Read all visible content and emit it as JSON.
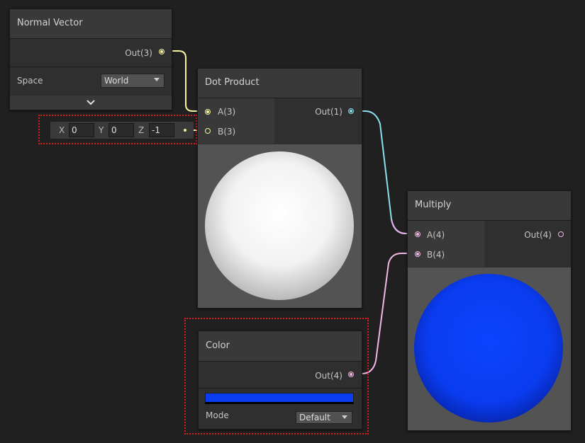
{
  "normal_vector": {
    "title": "Normal Vector",
    "out_label": "Out(3)",
    "space_label": "Space",
    "space_value": "World"
  },
  "vector_input": {
    "x_label": "X",
    "x_value": "0",
    "y_label": "Y",
    "y_value": "0",
    "z_label": "Z",
    "z_value": "-1"
  },
  "dot_product": {
    "title": "Dot Product",
    "input_a_label": "A(3)",
    "input_b_label": "B(3)",
    "out_label": "Out(1)"
  },
  "multiply": {
    "title": "Multiply",
    "input_a_label": "A(4)",
    "input_b_label": "B(4)",
    "out_label": "Out(4)"
  },
  "color_node": {
    "title": "Color",
    "out_label": "Out(4)",
    "swatch_color": "#0a3cf0",
    "mode_label": "Mode",
    "mode_value": "Default"
  },
  "colors": {
    "vector3_wire": "#f7f5a0",
    "float_wire": "#8be0f0",
    "vector4_wire": "#f0b8e6",
    "highlight": "#d61e1e"
  }
}
